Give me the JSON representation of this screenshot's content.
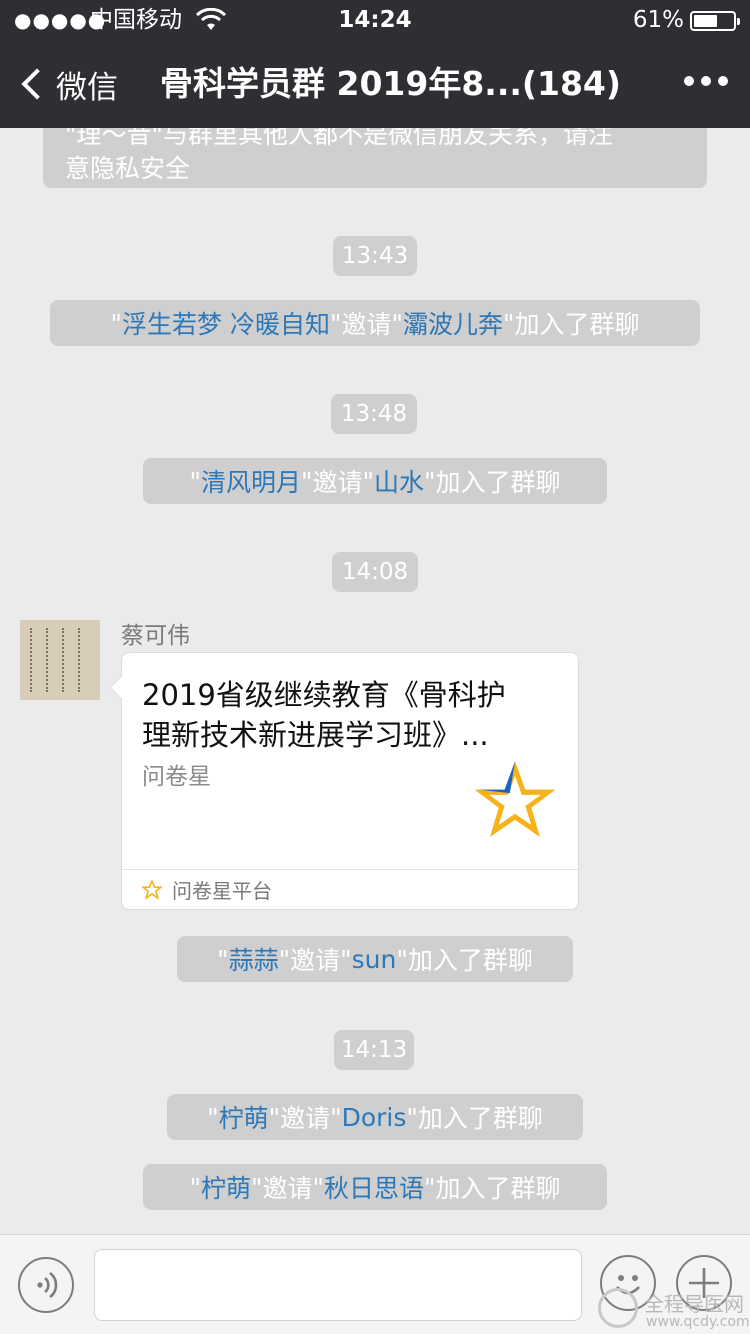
{
  "status_bar": {
    "signal": "●●●●●",
    "carrier": "中国移动",
    "time": "14:24",
    "battery_percent": "61%",
    "battery_level": 0.61
  },
  "nav": {
    "back_label": "微信",
    "title": "骨科学员群 2019年8...(184)"
  },
  "notice": {
    "line1": "\"理～昔\"与群里其他人都不是微信朋友关系，请注",
    "line2": "意隐私安全"
  },
  "timeline": [
    {
      "time": "13:43",
      "inviter": "浮生若梦  冷暖自知",
      "invitee": "灞波儿奔"
    },
    {
      "time": "13:48",
      "inviter": "清风明月",
      "invitee": "山水"
    },
    {
      "time": "14:08"
    }
  ],
  "message": {
    "sender": "蔡可伟",
    "card_title_line1": "2019省级继续教育《骨科护",
    "card_title_line2": "理新技术新进展学习班》...",
    "card_source": "问卷星",
    "card_platform": "问卷星平台",
    "star_colors": [
      "#1a63c6",
      "#f7b21a"
    ]
  },
  "invites_after": [
    {
      "inviter": "蒜蒜",
      "invitee": "sun"
    }
  ],
  "time_4": "14:13",
  "invites_last": [
    {
      "inviter": "柠萌",
      "invitee": "Doris"
    },
    {
      "inviter": "柠萌",
      "invitee": "秋日思语"
    }
  ],
  "invite_words": {
    "quote": "\"",
    "invite": "邀请",
    "joined": "加入了群聊"
  },
  "watermark": {
    "name": "全程导医网",
    "url": "www.qcdy.com"
  },
  "colors": {
    "nav_bg": "#2f2f33",
    "chat_bg": "#ebebeb",
    "system_bg": "#cfcfcf",
    "link": "#2e78b8"
  }
}
